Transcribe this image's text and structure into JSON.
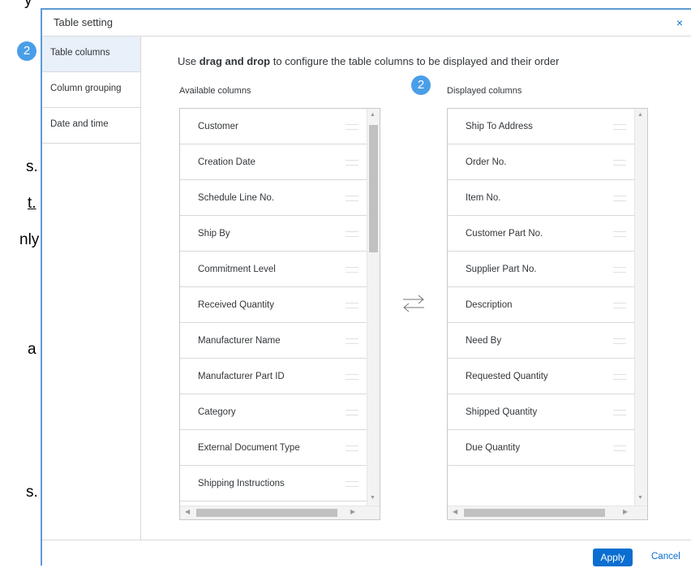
{
  "background_text": [
    {
      "text": "y"
    },
    {
      "text": "s."
    },
    {
      "text": "t."
    },
    {
      "text": "nly"
    },
    {
      "text": "a"
    },
    {
      "text": "s."
    }
  ],
  "dialog": {
    "title": "Table setting",
    "close_icon": "close-icon",
    "close_glyph": "×",
    "sidebar": {
      "items": [
        {
          "label": "Table columns",
          "active": true
        },
        {
          "label": "Column grouping",
          "active": false
        },
        {
          "label": "Date and time",
          "active": false
        }
      ]
    },
    "instruction": {
      "prefix": "Use ",
      "bold": "drag and drop",
      "suffix": " to configure the table columns to be displayed and their order"
    },
    "available": {
      "label": "Available columns",
      "items": [
        "Customer",
        "Creation Date",
        "Schedule Line No.",
        "Ship By",
        "Commitment Level",
        "Received Quantity",
        "Manufacturer Name",
        "Manufacturer Part ID",
        "Category",
        "External Document Type",
        "Shipping Instructions"
      ]
    },
    "displayed": {
      "label": "Displayed columns",
      "items": [
        "Ship To Address",
        "Order No.",
        "Item No.",
        "Customer Part No.",
        "Supplier Part No.",
        "Description",
        "Need By",
        "Requested Quantity",
        "Shipped Quantity",
        "Due Quantity"
      ]
    },
    "swap_icon": "swap-arrows-icon",
    "badges": [
      "2",
      "2"
    ],
    "footer": {
      "apply": "Apply",
      "cancel": "Cancel"
    }
  },
  "colors": {
    "accent": "#0a6ed1",
    "badge": "#4a9ee8",
    "border": "#5b9bd5",
    "active_tab": "#e8f0f9"
  }
}
